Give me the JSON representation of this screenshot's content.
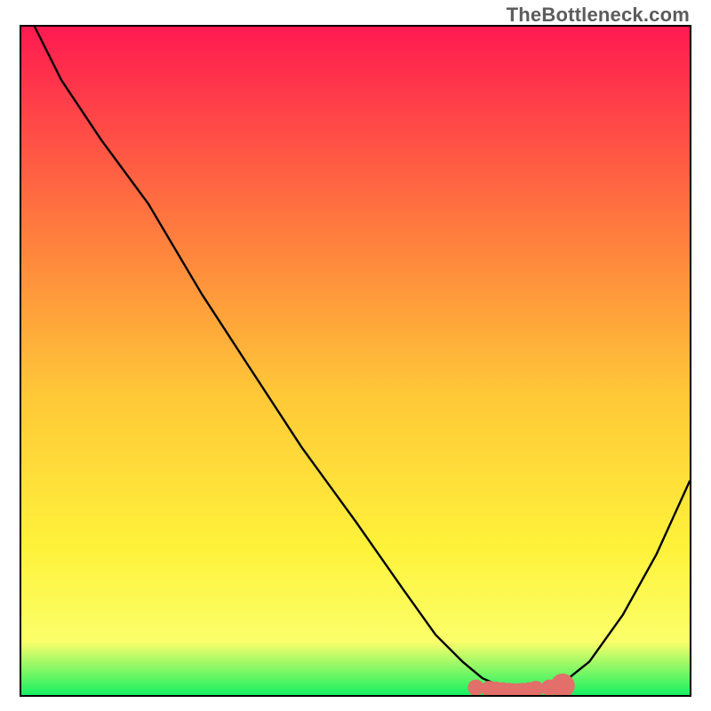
{
  "watermark": "TheBottleneck.com",
  "colors": {
    "gradient_top": "#ff1a50",
    "gradient_mid_upper": "#ff7a3e",
    "gradient_mid": "#ffc838",
    "gradient_mid_lower": "#fff23a",
    "gradient_lower": "#fbff6a",
    "gradient_bottom": "#17f062",
    "curve": "#000000",
    "marker": "#e26f6a"
  },
  "chart_data": {
    "type": "line",
    "title": "",
    "xlabel": "",
    "ylabel": "",
    "xlim": [
      0,
      100
    ],
    "ylim": [
      0,
      100
    ],
    "grid": false,
    "legend": false,
    "annotations": [],
    "series": [
      {
        "name": "curve",
        "x": [
          2,
          6,
          12,
          19,
          27,
          33.5,
          42,
          50,
          57,
          62,
          66,
          69,
          72,
          75,
          77,
          80,
          85,
          90,
          95,
          100
        ],
        "y": [
          100,
          92,
          83,
          73.5,
          60,
          50,
          37,
          26,
          16,
          9,
          5,
          2.5,
          1.2,
          0.5,
          0.3,
          1,
          5,
          12,
          21,
          32
        ]
      }
    ],
    "markers": {
      "name": "cluster",
      "x": [
        68,
        70,
        71,
        72,
        73,
        73.5,
        74,
        74.5,
        75,
        76,
        77,
        79,
        81
      ],
      "y": [
        1.1,
        0.9,
        0.8,
        0.7,
        0.6,
        0.55,
        0.5,
        0.55,
        0.6,
        0.7,
        0.9,
        1.1,
        1.4
      ],
      "r": [
        2.2,
        2.2,
        2.2,
        2.2,
        2.2,
        2.2,
        2.2,
        2.2,
        2.2,
        2.2,
        2.2,
        2.2,
        3.3
      ]
    }
  }
}
